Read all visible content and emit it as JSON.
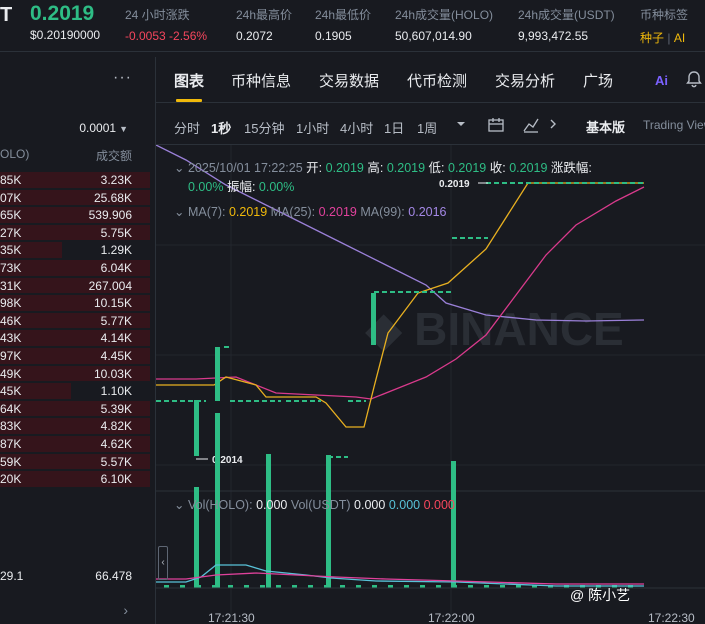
{
  "ticker": {
    "symbol": "T",
    "price": "0.2019",
    "price_usd": "$0.20190000",
    "stats": [
      {
        "label": "24 小时涨跌",
        "value": "-0.0053 -2.56%",
        "color": "red"
      },
      {
        "label": "24h最高价",
        "value": "0.2072"
      },
      {
        "label": "24h最低价",
        "value": "0.1905"
      },
      {
        "label": "24h成交量(HOLO)",
        "value": "50,607,014.90"
      },
      {
        "label": "24h成交量(USDT)",
        "value": "9,993,472.55"
      },
      {
        "label": "币种标签",
        "tag1": "种子",
        "tag_sep": "|",
        "tag2": "AI"
      }
    ]
  },
  "orderbook": {
    "more_label": "···",
    "precision": "0.0001",
    "header_price": "OLO)",
    "header_total": "成交额",
    "rows": [
      {
        "price": "85K",
        "total": "3.23K",
        "depth": 1.0
      },
      {
        "price": "07K",
        "total": "25.68K",
        "depth": 1.0
      },
      {
        "price": "65K",
        "total": "539.906",
        "depth": 1.0
      },
      {
        "price": "27K",
        "total": "5.75K",
        "depth": 1.0
      },
      {
        "price": "35K",
        "total": "1.29K",
        "depth": 0.41
      },
      {
        "price": "73K",
        "total": "6.04K",
        "depth": 1.0
      },
      {
        "price": "31K",
        "total": "267.004",
        "depth": 1.0
      },
      {
        "price": "98K",
        "total": "10.15K",
        "depth": 1.0
      },
      {
        "price": "46K",
        "total": "5.77K",
        "depth": 1.0
      },
      {
        "price": "43K",
        "total": "4.14K",
        "depth": 1.0
      },
      {
        "price": "97K",
        "total": "4.45K",
        "depth": 1.0
      },
      {
        "price": "49K",
        "total": "10.03K",
        "depth": 1.0
      },
      {
        "price": "45K",
        "total": "1.10K",
        "depth": 0.47
      },
      {
        "price": "64K",
        "total": "5.39K",
        "depth": 1.0
      },
      {
        "price": "83K",
        "total": "4.82K",
        "depth": 1.0
      },
      {
        "price": "87K",
        "total": "4.62K",
        "depth": 1.0
      },
      {
        "price": "59K",
        "total": "5.57K",
        "depth": 1.0
      },
      {
        "price": "20K",
        "total": "6.10K",
        "depth": 1.0
      }
    ],
    "last_price": "29.1",
    "last_total": "66.478",
    "chevron": "›"
  },
  "tabs": [
    "图表",
    "币种信息",
    "交易数据",
    "代币检测",
    "交易分析",
    "广场"
  ],
  "ai_label": "Ai",
  "intervals": [
    "分时",
    "1秒",
    "15分钟",
    "1小时",
    "4小时",
    "1日",
    "1周"
  ],
  "active_interval": "1秒",
  "view_modes": {
    "basic": "基本版",
    "tradingview": "Trading View"
  },
  "chart_legend": {
    "datetime": "2025/10/01 17:22:25",
    "open_label": "开:",
    "open": "0.2019",
    "high_label": "高:",
    "high": "0.2019",
    "low_label": "低:",
    "low": "0.2019",
    "close_label": "收:",
    "close": "0.2019",
    "change_label": "涨跌幅:",
    "change": "0.00%",
    "amplitude_label": "振幅:",
    "amplitude": "0.00%",
    "ma7_label": "MA(7):",
    "ma7": "0.2019",
    "ma25_label": "MA(25):",
    "ma25": "0.2019",
    "ma99_label": "MA(99):",
    "ma99": "0.2016",
    "vol_holo_label": "Vol(HOLO):",
    "vol_holo": "0.000",
    "vol_usdt_label": "Vol(USDT)",
    "vol_usdt": "0.000",
    "vol_ma1": "0.000",
    "vol_ma2": "0.000",
    "high_marker": "0.2019",
    "low_marker": "0.2014"
  },
  "time_labels": [
    "17:21:30",
    "17:22:00",
    "17:22:30"
  ],
  "watermark": "@ 陈小艺",
  "chart_data": {
    "type": "line",
    "title": "",
    "price_range": [
      0.201,
      0.2021
    ],
    "candles": [
      {
        "t": 0,
        "open": 0.20165,
        "close": 0.20165,
        "high": 0.20165,
        "low": 0.20165
      },
      {
        "t": 1,
        "open": 0.20165,
        "close": 0.2014,
        "high": 0.20165,
        "low": 0.2014
      },
      {
        "t": 2,
        "open": 0.20165,
        "close": 0.2018,
        "high": 0.2018,
        "low": 0.20165
      },
      {
        "t": 3,
        "open": 0.20165,
        "close": 0.20165,
        "high": 0.20165,
        "low": 0.20165
      },
      {
        "t": 4,
        "open": 0.20165,
        "close": 0.20165,
        "high": 0.20165,
        "low": 0.20165
      },
      {
        "t": 5,
        "open": 0.20165,
        "close": 0.20165,
        "high": 0.20165,
        "low": 0.20165
      },
      {
        "t": 6,
        "open": 0.20145,
        "close": 0.20145,
        "high": 0.20145,
        "low": 0.20145
      },
      {
        "t": 7,
        "open": 0.20175,
        "close": 0.20185,
        "high": 0.20185,
        "low": 0.20175
      },
      {
        "t": 8,
        "open": 0.20185,
        "close": 0.20185,
        "high": 0.20185,
        "low": 0.20185
      },
      {
        "t": 9,
        "open": 0.20185,
        "close": 0.20185,
        "high": 0.20185,
        "low": 0.20185
      },
      {
        "t": 10,
        "open": 0.20185,
        "close": 0.20185,
        "high": 0.20185,
        "low": 0.20185
      },
      {
        "t": 11,
        "open": 0.202,
        "close": 0.202,
        "high": 0.202,
        "low": 0.202
      },
      {
        "t": 12,
        "open": 0.2019,
        "close": 0.2019,
        "high": 0.2019,
        "low": 0.2019
      },
      {
        "t": 13,
        "open": 0.2019,
        "close": 0.2019,
        "high": 0.2019,
        "low": 0.2019
      }
    ],
    "ma7": [
      0.20174,
      0.20174,
      0.20172,
      0.20168,
      0.20168,
      0.20162,
      0.2016,
      0.20176,
      0.20188,
      0.202,
      0.202,
      0.202,
      0.202
    ],
    "ma25": [
      0.20173,
      0.20173,
      0.2017,
      0.20168,
      0.20165,
      0.20165,
      0.2017,
      0.20175,
      0.2018,
      0.20184,
      0.20188,
      0.20193,
      0.20196
    ],
    "ma99": [
      0.202,
      0.20198,
      0.20193,
      0.20188,
      0.20182,
      0.20177,
      0.20175,
      0.20175,
      0.20175
    ]
  }
}
